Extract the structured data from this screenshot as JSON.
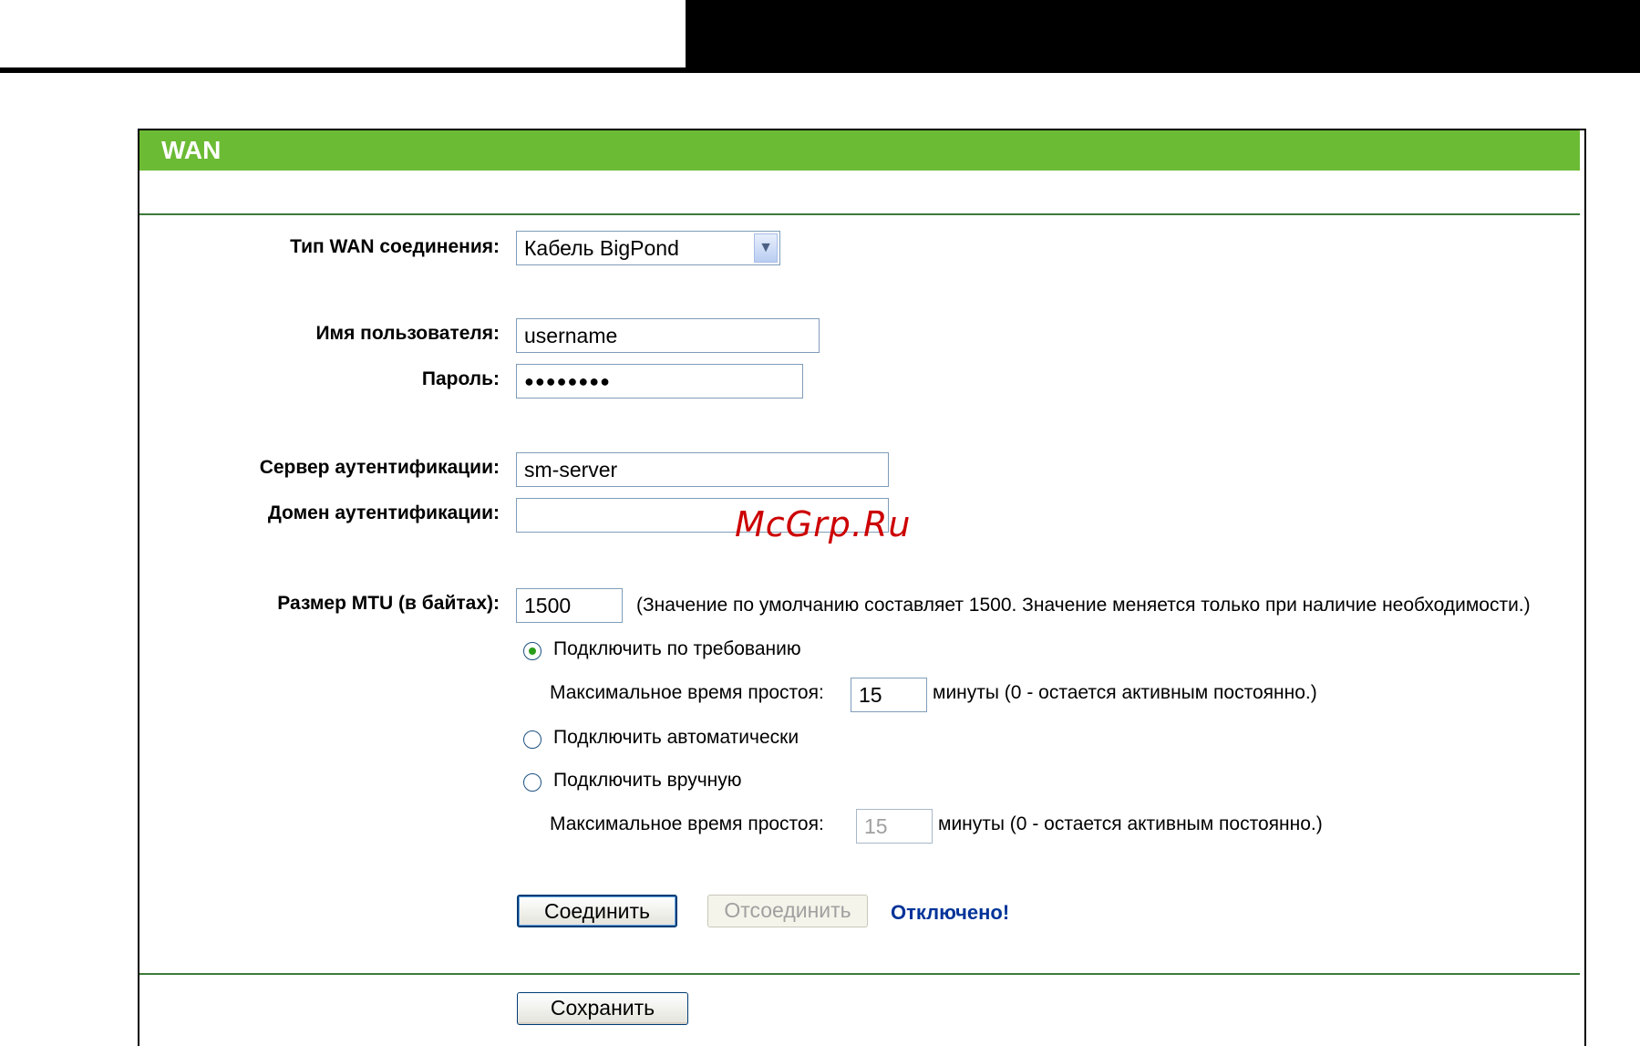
{
  "watermark": "McGrp.Ru",
  "panel": {
    "title": "WAN",
    "header_color": "#6cbb34"
  },
  "wan_type": {
    "label": "Тип WAN соединения:",
    "value": "Кабель BigPond"
  },
  "username": {
    "label": "Имя пользователя:",
    "value": "username"
  },
  "password": {
    "label": "Пароль:",
    "value": "●●●●●●●●"
  },
  "auth_server": {
    "label": "Сервер аутентификации:",
    "value": "sm-server"
  },
  "auth_domain": {
    "label": "Домен аутентификации:",
    "value": ""
  },
  "mtu": {
    "label": "Размер MTU (в байтах):",
    "value": "1500",
    "hint": "(Значение по умолчанию составляет 1500. Значение меняется только при наличие необходимости.)"
  },
  "connect_modes": {
    "on_demand": {
      "label": "Подключить по требованию",
      "selected": true
    },
    "idle_1": {
      "label": "Максимальное время простоя:",
      "value": "15",
      "suffix": "минуты (0 - остается активным постоянно.)"
    },
    "auto": {
      "label": "Подключить автоматически",
      "selected": false
    },
    "manual": {
      "label": "Подключить вручную",
      "selected": false
    },
    "idle_2": {
      "label": "Максимальное время простоя:",
      "value": "15",
      "suffix": "минуты (0 - остается активным постоянно.)"
    }
  },
  "buttons": {
    "connect": "Соединить",
    "disconnect": "Отсоединить",
    "save": "Сохранить"
  },
  "status": {
    "text": "Отключено!",
    "color": "#003399"
  }
}
